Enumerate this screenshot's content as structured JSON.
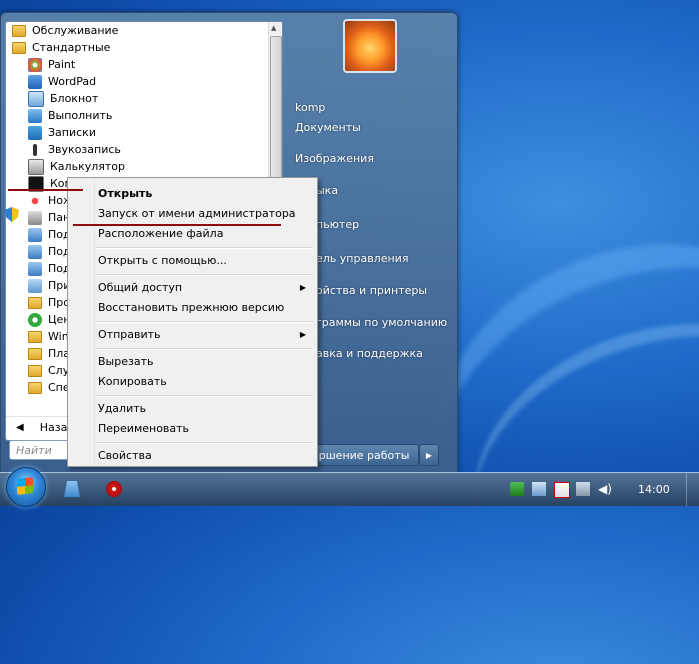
{
  "start_menu": {
    "programs": [
      {
        "label": "Обслуживание",
        "icon": "folder-icon"
      },
      {
        "label": "Стандартные",
        "icon": "folder-icon"
      },
      {
        "label": "Paint",
        "icon": "paint-icon"
      },
      {
        "label": "WordPad",
        "icon": "wordpad-icon"
      },
      {
        "label": "Блокнот",
        "icon": "notepad-icon"
      },
      {
        "label": "Выполнить",
        "icon": "run-icon"
      },
      {
        "label": "Записки",
        "icon": "sticky-notes-icon"
      },
      {
        "label": "Звукозапись",
        "icon": "sound-recorder-icon"
      },
      {
        "label": "Калькулятор",
        "icon": "calculator-icon"
      },
      {
        "label": "Ком",
        "icon": "command-prompt-icon"
      },
      {
        "label": "Нож",
        "icon": "snipping-tool-icon"
      },
      {
        "label": "Пан",
        "icon": "panel-icon"
      },
      {
        "label": "Под",
        "icon": "connect-icon"
      },
      {
        "label": "Под",
        "icon": "connect-icon"
      },
      {
        "label": "Под",
        "icon": "connect-icon"
      },
      {
        "label": "При",
        "icon": "app-icon"
      },
      {
        "label": "Про",
        "icon": "folder-icon"
      },
      {
        "label": "Цен",
        "icon": "sync-center-icon"
      },
      {
        "label": "Wind",
        "icon": "folder-icon"
      },
      {
        "label": "Пла",
        "icon": "folder-icon"
      },
      {
        "label": "Слу",
        "icon": "folder-icon"
      },
      {
        "label": "Спе",
        "icon": "folder-icon"
      }
    ],
    "back_label": "Наза",
    "search_placeholder": "Найти",
    "right_items": [
      "komp",
      "Документы",
      "Изображения",
      "ыка",
      "пьютер",
      "ель управления",
      "ойства и принтеры",
      "граммы по умолчанию",
      "авка и поддержка"
    ],
    "shutdown_label": "ршение работы"
  },
  "context_menu": {
    "items": [
      {
        "label": "Открыть",
        "bold": true,
        "submenu": false
      },
      {
        "label": "Запуск от имени администратора",
        "bold": false,
        "submenu": false
      },
      {
        "label": "Расположение файла",
        "bold": false,
        "submenu": false
      },
      {
        "label": "Открыть с помощью...",
        "bold": false,
        "submenu": false
      },
      {
        "label": "Общий доступ",
        "bold": false,
        "submenu": true
      },
      {
        "label": "Восстановить прежнюю версию",
        "bold": false,
        "submenu": false
      },
      {
        "label": "Отправить",
        "bold": false,
        "submenu": true
      },
      {
        "label": "Вырезать",
        "bold": false,
        "submenu": false
      },
      {
        "label": "Копировать",
        "bold": false,
        "submenu": false
      },
      {
        "label": "Удалить",
        "bold": false,
        "submenu": false
      },
      {
        "label": "Переименовать",
        "bold": false,
        "submenu": false
      },
      {
        "label": "Свойства",
        "bold": false,
        "submenu": false
      }
    ]
  },
  "taskbar": {
    "clock": "14:00",
    "pinned": [
      "explorer-icon",
      "antivirus-icon"
    ],
    "tray": [
      "network-shield-icon",
      "flag-icon",
      "action-center-icon",
      "network-icon",
      "volume-icon"
    ]
  },
  "colors": {
    "highlight_line": "#8a0c0c",
    "desktop": "#1f6ac8"
  }
}
